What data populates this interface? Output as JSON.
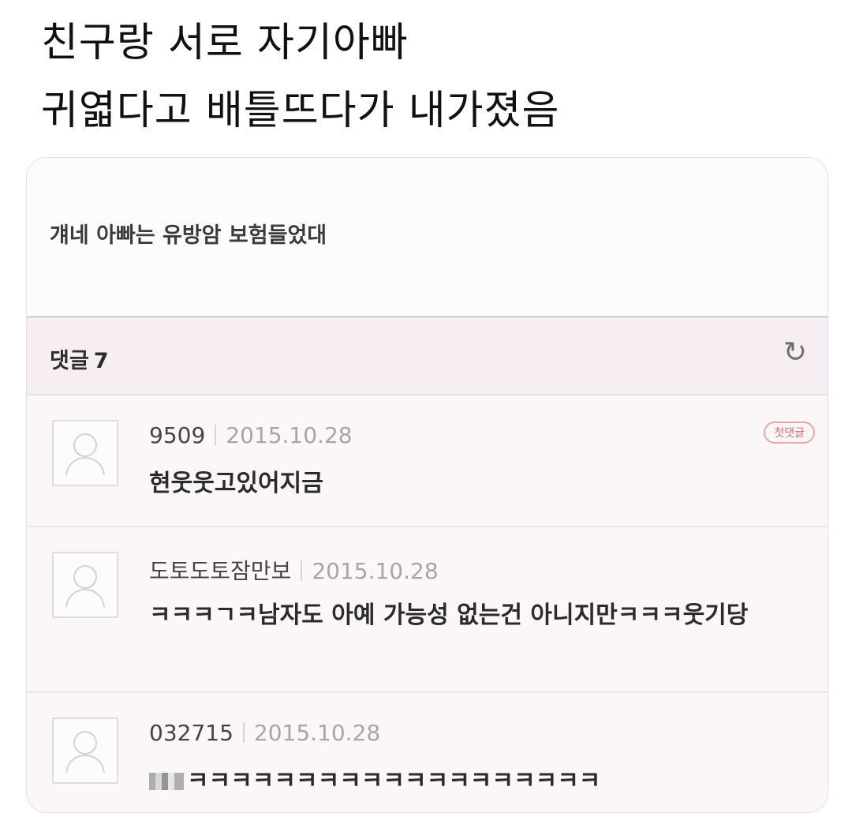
{
  "caption": {
    "line1": "친구랑 서로 자기아빠",
    "line2": "귀엷다고 배틀뜨다가 내가졌음"
  },
  "post": {
    "text": "걔네 아빠는 유방암 보험들었대"
  },
  "comments_header": {
    "label": "댓글",
    "count": "7",
    "refresh_icon": "refresh-icon"
  },
  "comments": [
    {
      "author": "9509",
      "date": "2015.10.28",
      "text": "현웃웃고있어지금",
      "badge": "첫댓글"
    },
    {
      "author": "도토도토잠만보",
      "date": "2015.10.28",
      "text": "ㅋㅋㅋㄱㅋ남자도 아예 가능성 없는건 아니지만ㅋㅋㅋ웃기당"
    },
    {
      "author": "032715",
      "date": "2015.10.28",
      "text": "ㅋㅋㅋㅋㅋㅋㅋㅋㅋㅋㅋㅋㅋㅋㅋㅋㅋㅋㅋ"
    }
  ]
}
